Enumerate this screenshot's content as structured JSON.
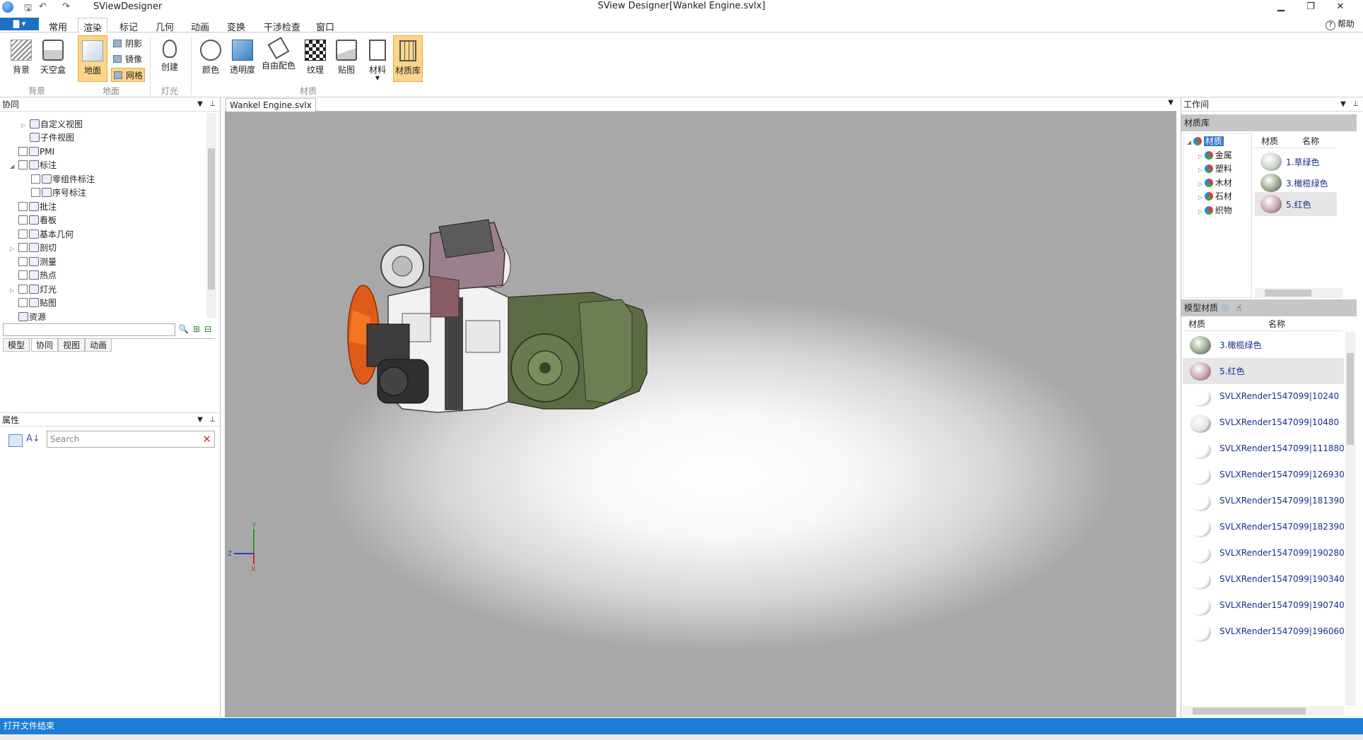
{
  "titlebar": {
    "app_name": "SViewDesigner",
    "doc_title": "SView Designer[Wankel Engine.svlx]",
    "minimize": "▁",
    "restore": "❐",
    "close": "✕"
  },
  "menu": {
    "tabs": [
      "常用",
      "渲染",
      "标记",
      "几何",
      "动画",
      "变换",
      "干涉检查",
      "窗口"
    ],
    "active_tab": "渲染",
    "help": "帮助"
  },
  "ribbon": {
    "background": "背景",
    "skybox": "天空盒",
    "ground": "地面",
    "shadow": "阴影",
    "mirror": "镜像",
    "grid": "网格",
    "create": "创建",
    "color": "颜色",
    "transparency": "透明度",
    "free_color": "自由配色",
    "texture": "纹理",
    "decal": "贴图",
    "material": "材料",
    "material_lib": "材质库",
    "groups": [
      "背景",
      "地面",
      "灯光",
      "材质"
    ]
  },
  "left_panel": {
    "title": "协同",
    "tree": [
      "自定义视图",
      "子件视图",
      "PMI",
      "标注",
      "零组件标注",
      "序号标注",
      "批注",
      "看板",
      "基本几何",
      "剖切",
      "测量",
      "热点",
      "灯光",
      "贴图",
      "资源"
    ],
    "tabs": [
      "模型",
      "协同",
      "视图",
      "动画"
    ],
    "active_tab": "协同",
    "props_title": "属性",
    "search_placeholder": "Search"
  },
  "viewport": {
    "doc_tab": "Wankel Engine.svlx",
    "axis_y": "Y",
    "axis_z": "Z",
    "axis_x": "X"
  },
  "right_panel": {
    "title": "工作间",
    "lib_title": "材质库",
    "lib_tree": [
      "材质",
      "金属",
      "塑料",
      "木材",
      "石材",
      "织物"
    ],
    "lib_headers": [
      "材质",
      "名称"
    ],
    "lib_items": [
      {
        "name": "1.草绿色",
        "color": "#c9d2c9"
      },
      {
        "name": "3.橄榄绿色",
        "color": "#9aa98a"
      },
      {
        "name": "5.红色",
        "color": "#c8a6ad"
      }
    ],
    "model_mat_title": "模型材质",
    "model_headers": [
      "材质",
      "名称"
    ],
    "model_items": [
      {
        "name": "3.橄榄绿色",
        "color": "#9aa98a"
      },
      {
        "name": "5.红色",
        "color": "#c8a6ad"
      },
      {
        "name": "SVLXRender1547099|10240",
        "color": "#ffffff"
      },
      {
        "name": "SVLXRender1547099|10480",
        "color": "#e6e6e6"
      },
      {
        "name": "SVLXRender1547099|111880",
        "color": "#ffffff"
      },
      {
        "name": "SVLXRender1547099|126930",
        "color": "#ffffff"
      },
      {
        "name": "SVLXRender1547099|181390",
        "color": "#ffffff"
      },
      {
        "name": "SVLXRender1547099|182390",
        "color": "#ffffff"
      },
      {
        "name": "SVLXRender1547099|190280",
        "color": "#ffffff"
      },
      {
        "name": "SVLXRender1547099|190340",
        "color": "#ffffff"
      },
      {
        "name": "SVLXRender1547099|190740",
        "color": "#ffffff"
      },
      {
        "name": "SVLXRender1547099|196060",
        "color": "#ffffff"
      }
    ]
  },
  "status": {
    "message": "打开文件结束"
  }
}
